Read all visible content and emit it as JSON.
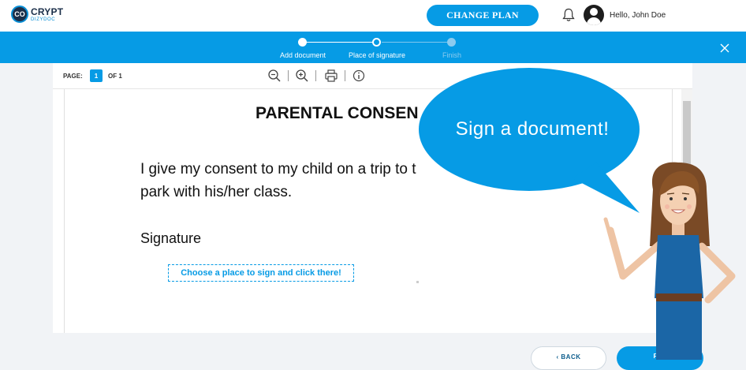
{
  "header": {
    "logo_word": "CRYPT",
    "logo_sub": "DIZYDOC",
    "logo_badge": "CO",
    "change_plan_label": "CHANGE PLAN",
    "greeting": "Hello, John Doe"
  },
  "steps": [
    {
      "label": "Add document",
      "state": "done"
    },
    {
      "label": "Place of signature",
      "state": "current"
    },
    {
      "label": "Finish",
      "state": "upcoming"
    }
  ],
  "toolbar": {
    "page_label": "PAGE:",
    "page_current": "1",
    "page_of": "OF 1",
    "tools": [
      "zoom-out-icon",
      "zoom-in-icon",
      "print-icon",
      "info-icon"
    ]
  },
  "document": {
    "title": "PARENTAL CONSEN",
    "body_line1": "I give my consent to my child on a trip to t",
    "body_line2": "park with his/her class.",
    "signature_label": "Signature",
    "sign_placeholder": "Choose a place to sign and click there!"
  },
  "footer": {
    "back_label": "‹ BACK",
    "finish_label": "FINI"
  },
  "overlay": {
    "bubble_text": "Sign a document!"
  },
  "colors": {
    "accent": "#069be5",
    "bubble": "#069be5",
    "dark": "#1b2f4a"
  }
}
